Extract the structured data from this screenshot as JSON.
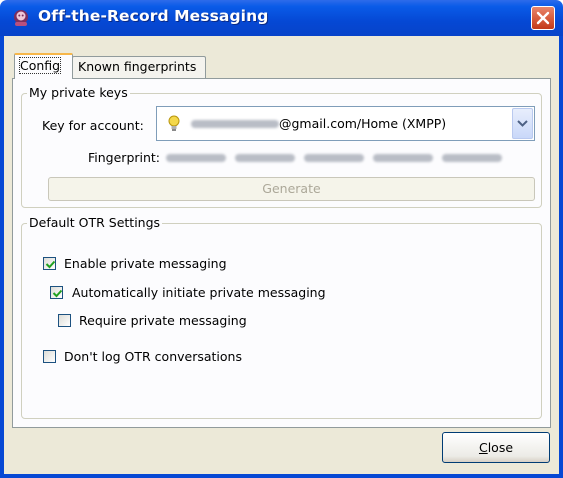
{
  "window": {
    "title": "Off-the-Record Messaging"
  },
  "tabs": [
    {
      "label": "Config",
      "active": true
    },
    {
      "label": "Known fingerprints",
      "active": false
    }
  ],
  "private_keys": {
    "group_title": "My private keys",
    "account_label": "Key for account:",
    "account_value": "@gmail.com/Home (XMPP)",
    "fingerprint_label": "Fingerprint:",
    "generate_label": "Generate"
  },
  "otr_settings": {
    "group_title": "Default OTR Settings",
    "options": [
      {
        "label": "Enable private messaging",
        "checked": true
      },
      {
        "label": "Automatically initiate private messaging",
        "checked": true
      },
      {
        "label": "Require private messaging",
        "checked": false
      },
      {
        "label": "Don't log OTR conversations",
        "checked": false
      }
    ]
  },
  "footer": {
    "close_mnemonic": "C",
    "close_rest": "lose"
  }
}
